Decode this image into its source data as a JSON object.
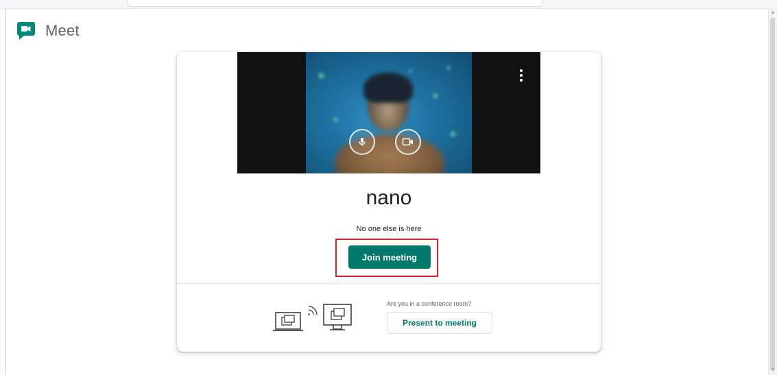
{
  "app": {
    "name": "Meet"
  },
  "preview": {
    "user_name": "nano",
    "more_options_icon": "more-vert-icon",
    "mic_icon": "mic-icon",
    "camera_icon": "videocam-icon"
  },
  "lobby": {
    "status": "No one else is here",
    "join_label": "Join meeting"
  },
  "conference_room": {
    "question": "Are you in a conference room?",
    "present_label": "Present to meeting"
  },
  "colors": {
    "accent": "#00796b",
    "annotation": "#e02020",
    "logo": "#00897b"
  }
}
